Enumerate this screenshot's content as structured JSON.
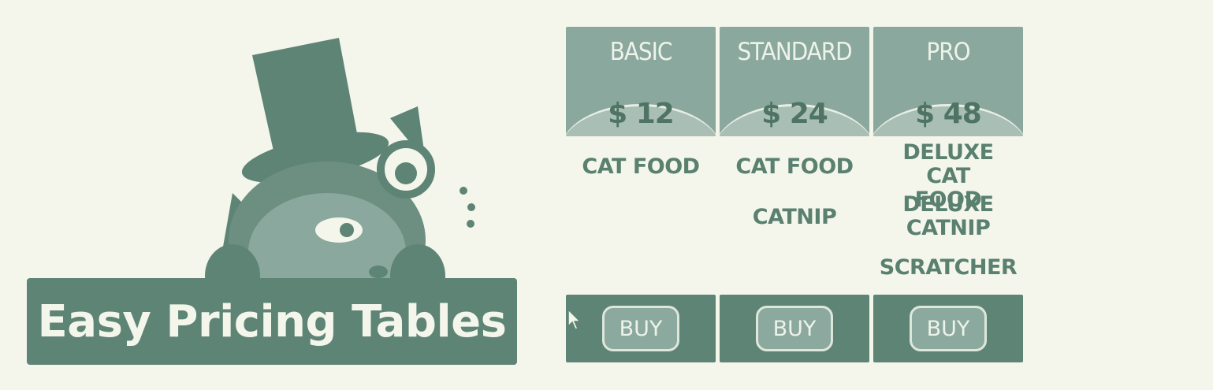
{
  "banner": {
    "title": "Easy Pricing Tables"
  },
  "plans": [
    {
      "name": "BASIC",
      "price": "$ 12",
      "features": [
        "CAT FOOD"
      ],
      "button": "BUY"
    },
    {
      "name": "STANDARD",
      "price": "$ 24",
      "features": [
        "CAT FOOD",
        "CATNIP"
      ],
      "button": "BUY"
    },
    {
      "name": "PRO",
      "price": "$ 48",
      "features": [
        "DELUXE CAT FOOD",
        "DELUXE CATNIP",
        "SCRATCHER"
      ],
      "button": "BUY"
    }
  ],
  "colors": {
    "background": "#f4f6ec",
    "accent": "#5e8475",
    "light_accent": "#8aa89d"
  },
  "icons": [
    "cat-mascot-icon",
    "mouse-cursor-icon"
  ]
}
